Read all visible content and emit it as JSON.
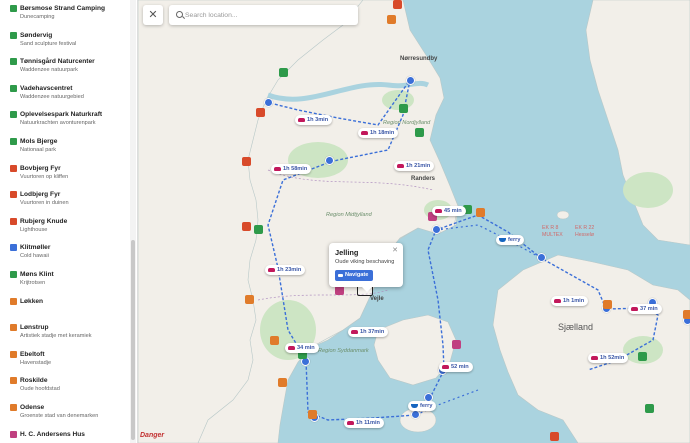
{
  "sidebar": {
    "places": [
      {
        "name": "Børsmose Strand Camping",
        "sub": "Dunecamping",
        "color": "#2e9a4a"
      },
      {
        "name": "Søndervig",
        "sub": "Sand sculpture festival",
        "color": "#2e9a4a"
      },
      {
        "name": "Tønnisgård Naturcenter",
        "sub": "Waddenzee natuurpark",
        "color": "#2e9a4a"
      },
      {
        "name": "Vadehavscentret",
        "sub": "Waddenzee natuurgebied",
        "color": "#2e9a4a"
      },
      {
        "name": "Oplevelsespark Naturkraft",
        "sub": "Natuurkrachten avonturenpark",
        "color": "#2e9a4a"
      },
      {
        "name": "Mols Bjerge",
        "sub": "Nationaal park",
        "color": "#2e9a4a"
      },
      {
        "name": "Bovbjerg Fyr",
        "sub": "Vuurtoren op kliffen",
        "color": "#d84a2a"
      },
      {
        "name": "Lodbjerg Fyr",
        "sub": "Vuurtoren in duinen",
        "color": "#d84a2a"
      },
      {
        "name": "Rubjerg Knude",
        "sub": "Lighthouse",
        "color": "#d84a2a"
      },
      {
        "name": "Klitmøller",
        "sub": "Cold hawaii",
        "color": "#3b6fd8"
      },
      {
        "name": "Møns Klint",
        "sub": "Krijtrotsen",
        "color": "#2e9a4a"
      },
      {
        "name": "Løkken",
        "sub": "",
        "color": "#e07b2a"
      },
      {
        "name": "Lønstrup",
        "sub": "Artistiek stadje met keramiek",
        "color": "#e07b2a"
      },
      {
        "name": "Ebeltoft",
        "sub": "Havenstadje",
        "color": "#e07b2a"
      },
      {
        "name": "Roskilde",
        "sub": "Oude hoofdstad",
        "color": "#e07b2a"
      },
      {
        "name": "Odense",
        "sub": "Groenste stad van denemarken",
        "color": "#e07b2a"
      },
      {
        "name": "H. C. Andersens Hus",
        "sub": "",
        "color": "#c04080"
      }
    ]
  },
  "toolbar": {
    "close_label": "✕",
    "search_placeholder": "Search location..."
  },
  "popup": {
    "title": "Jelling",
    "subtitle": "Oude viking beschaving",
    "button_label": "Navigate",
    "close_label": "✕"
  },
  "routes": [
    {
      "label": "1h 3min",
      "mode": "car"
    },
    {
      "label": "1h 18min",
      "mode": "car"
    },
    {
      "label": "1h 21min",
      "mode": "car"
    },
    {
      "label": "1h 58min",
      "mode": "car"
    },
    {
      "label": "45 min",
      "mode": "car"
    },
    {
      "label": "ferry",
      "mode": "ferry"
    },
    {
      "label": "1h 23min",
      "mode": "car"
    },
    {
      "label": "1h 1min",
      "mode": "car"
    },
    {
      "label": "37 min",
      "mode": "car"
    },
    {
      "label": "1h 37min",
      "mode": "car"
    },
    {
      "label": "34 min",
      "mode": "car"
    },
    {
      "label": "1h 52min",
      "mode": "car"
    },
    {
      "label": "52 min",
      "mode": "car"
    },
    {
      "label": "ferry",
      "mode": "ferry"
    },
    {
      "label": "1h 11min",
      "mode": "car"
    }
  ],
  "map_labels": {
    "norresundby": "Nørresundby",
    "region_nordjylland": "Region Nordjylland",
    "randers": "Randers",
    "region_midtjylland": "Region Midtjylland",
    "vejle": "Vejle",
    "region_syddanmark": "Region Syddanmark",
    "sjaelland": "Sjælland",
    "danger": "Danger",
    "ekr8": "EK R 8",
    "multex": "MULTEX",
    "ekr22": "EK R 22",
    "hesselo": "Hesselø"
  },
  "colors": {
    "sea": "#aad3df",
    "land": "#f2efe9",
    "nature": "#cde5c4",
    "route": "#3b6fd8"
  }
}
